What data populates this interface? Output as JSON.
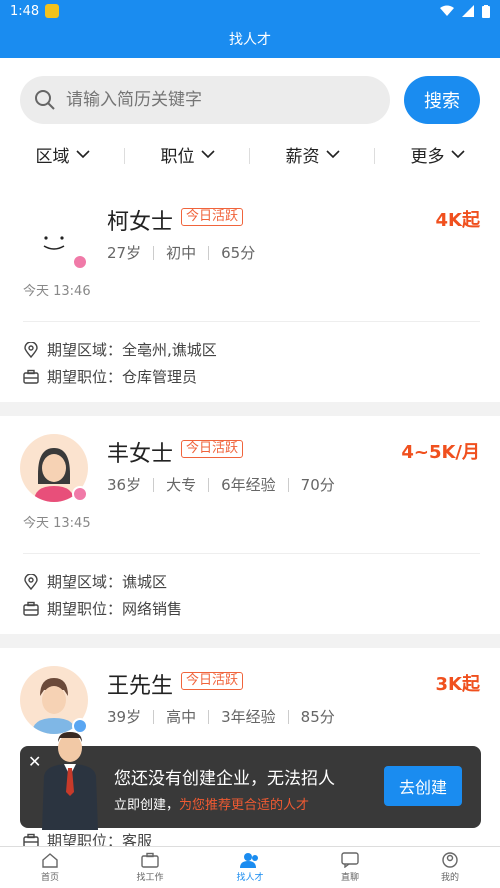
{
  "status": {
    "time": "1:48"
  },
  "header": {
    "title": "找人才"
  },
  "search": {
    "placeholder": "请输入简历关键字",
    "button": "搜索"
  },
  "filters": [
    "区域",
    "职位",
    "薪资",
    "更多"
  ],
  "candidates": [
    {
      "name": "柯女士",
      "tag": "今日活跃",
      "salary": "4K起",
      "meta": [
        "27岁",
        "初中",
        "65分"
      ],
      "time": "今天 13:46",
      "area_label": "期望区域：",
      "area": "全亳州,谯城区",
      "job_label": "期望职位：",
      "job": "仓库管理员",
      "gender": "female"
    },
    {
      "name": "丰女士",
      "tag": "今日活跃",
      "salary": "4~5K/月",
      "meta": [
        "36岁",
        "大专",
        "6年经验",
        "70分"
      ],
      "time": "今天 13:45",
      "area_label": "期望区域：",
      "area": "谯城区",
      "job_label": "期望职位：",
      "job": "网络销售",
      "gender": "female"
    },
    {
      "name": "王先生",
      "tag": "今日活跃",
      "salary": "3K起",
      "meta": [
        "39岁",
        "高中",
        "3年经验",
        "85分"
      ],
      "time": "",
      "area_label": "",
      "area": "",
      "job_label": "期望职位：",
      "job": "客服",
      "gender": "male"
    }
  ],
  "overlay": {
    "title": "您还没有创建企业，无法招人",
    "sub_prefix": "立即创建，",
    "sub_highlight": "为您推荐更合适的人才",
    "button": "去创建"
  },
  "tabs": [
    "首页",
    "找工作",
    "找人才",
    "直聊",
    "我的"
  ],
  "colors": {
    "primary": "#1a8cf0",
    "accent": "#f0501e"
  }
}
